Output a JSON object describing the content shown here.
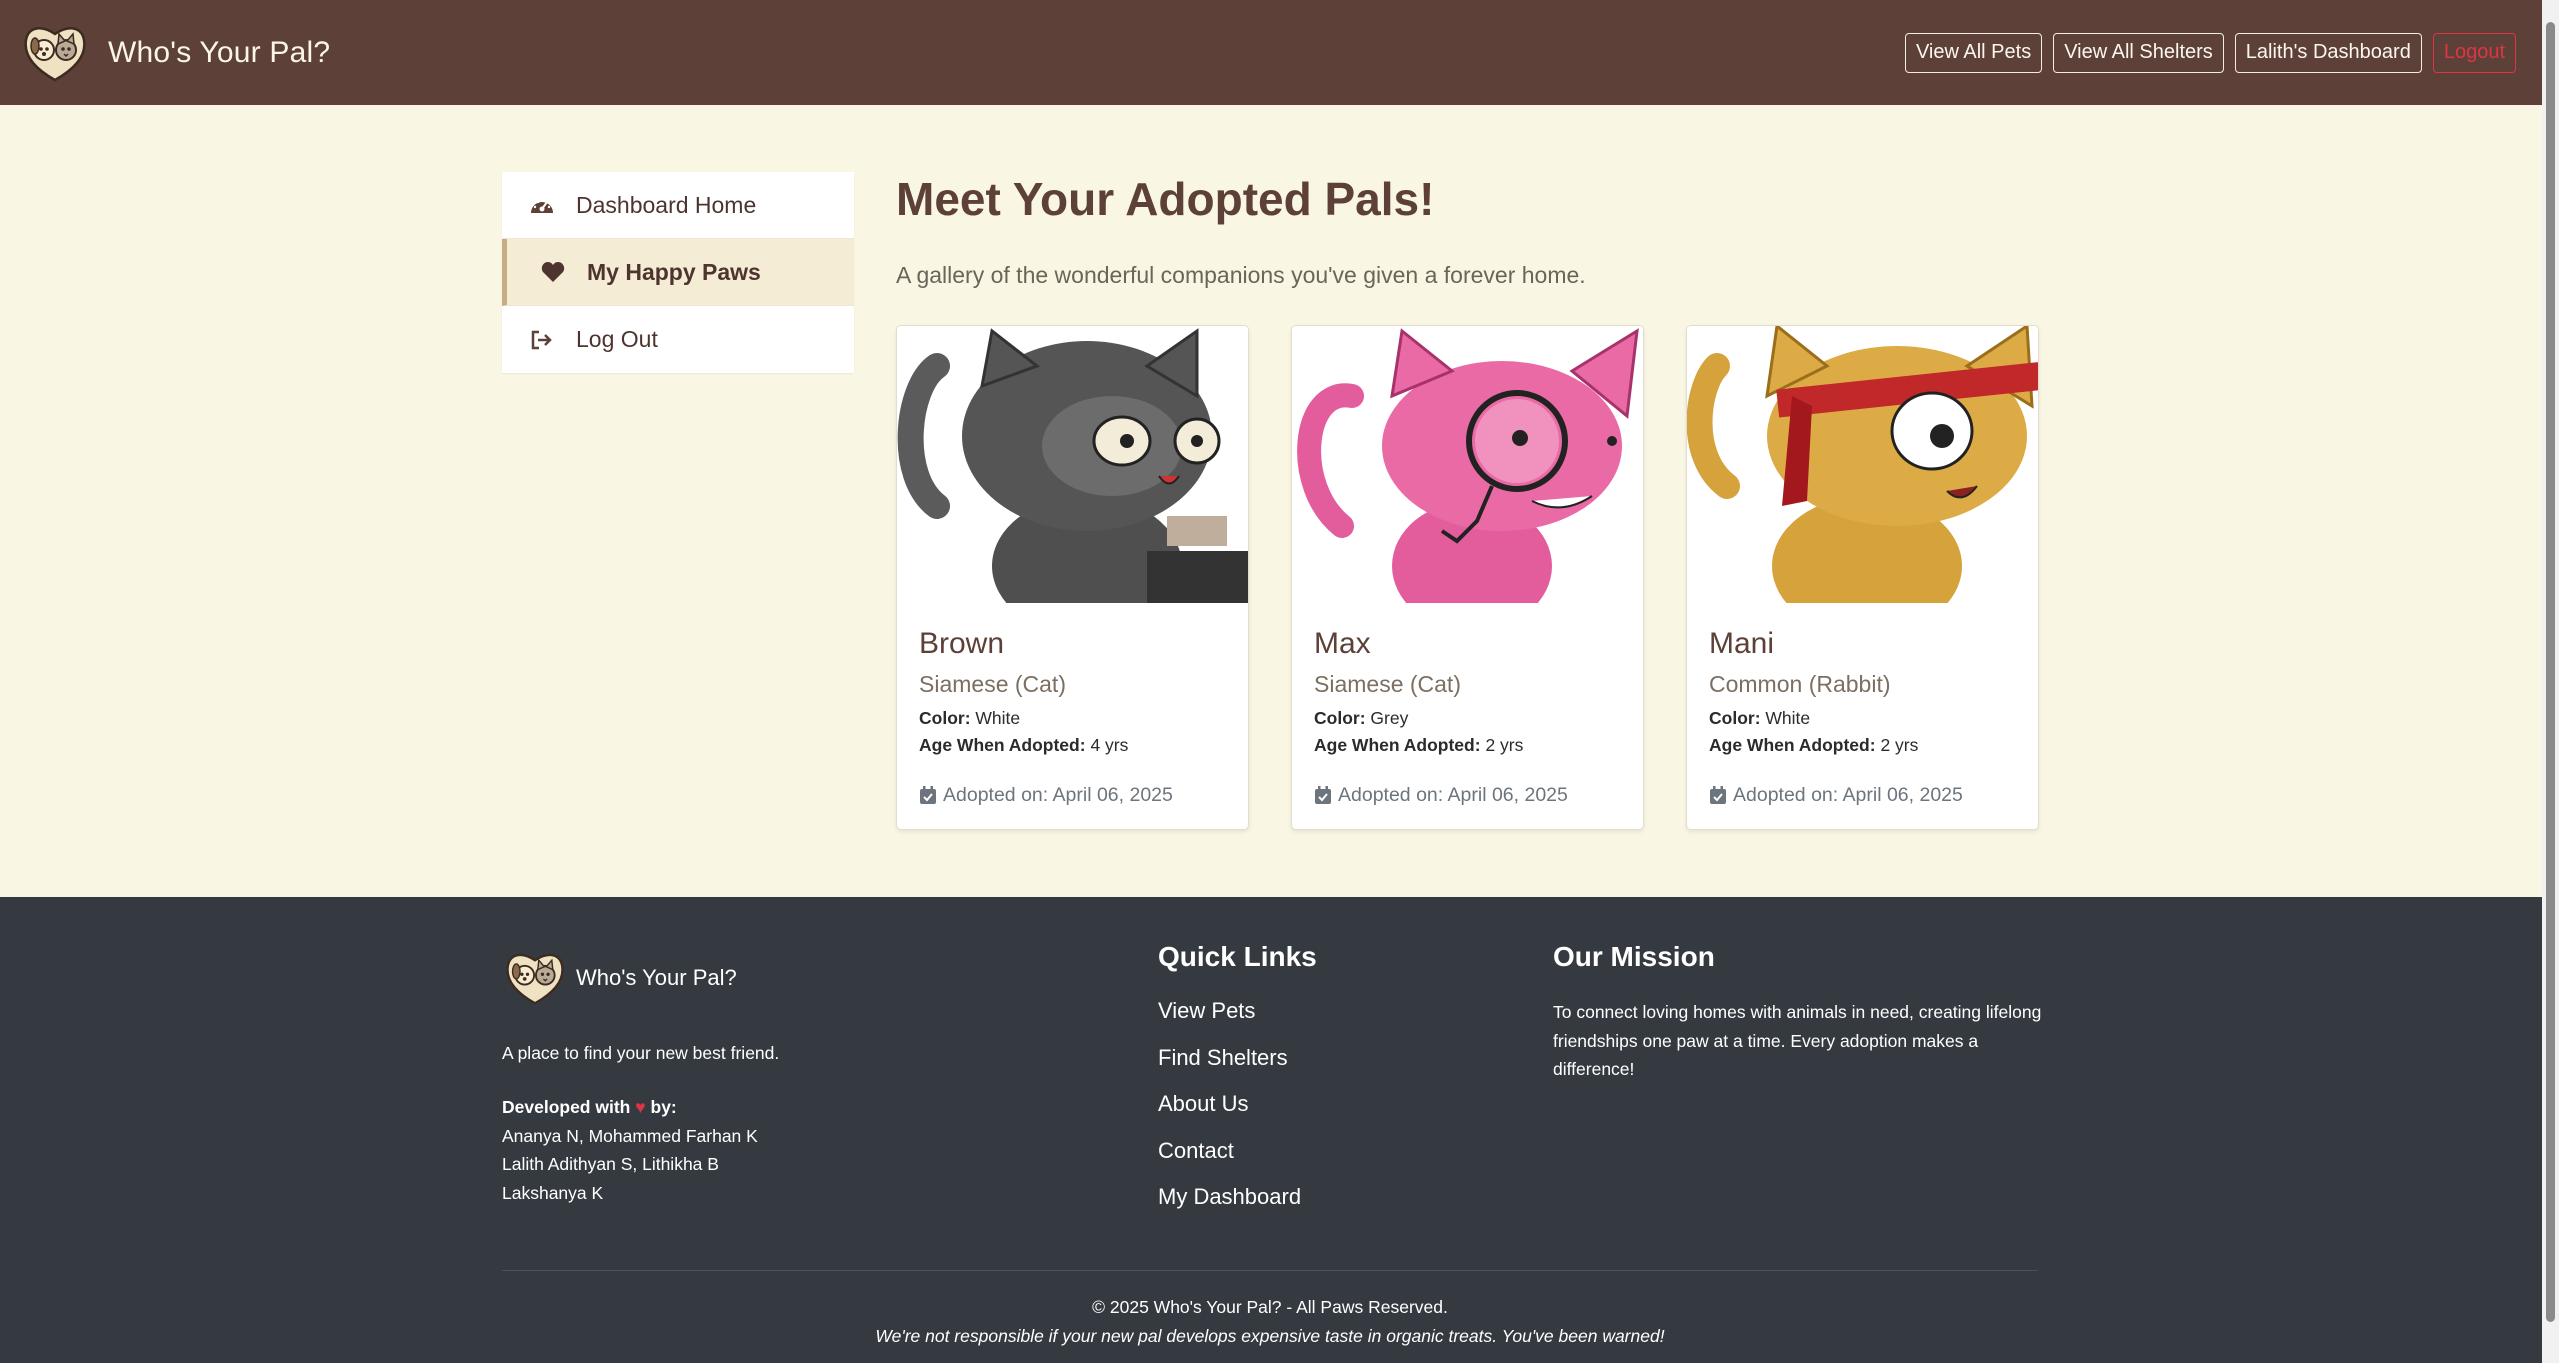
{
  "navbar": {
    "brand": "Who's Your Pal?",
    "buttons": {
      "view_pets": "View All Pets",
      "view_shelters": "View All Shelters",
      "dashboard": "Lalith's Dashboard",
      "logout": "Logout"
    }
  },
  "sidebar": {
    "items": [
      {
        "label": "Dashboard Home",
        "icon": "dashboard-icon"
      },
      {
        "label": "My Happy Paws",
        "icon": "heart-icon",
        "active": true
      },
      {
        "label": "Log Out",
        "icon": "sign-out-icon"
      }
    ]
  },
  "main": {
    "title": "Meet Your Adopted Pals!",
    "subtitle": "A gallery of the wonderful companions you've given a forever home.",
    "color_label": "Color:",
    "age_label": "Age When Adopted:",
    "pets": [
      {
        "name": "Brown",
        "breed": "Siamese (Cat)",
        "color": "White",
        "age": "4 yrs",
        "adopted": "Adopted on: April 06, 2025"
      },
      {
        "name": "Max",
        "breed": "Siamese (Cat)",
        "color": "Grey",
        "age": "2 yrs",
        "adopted": "Adopted on: April 06, 2025"
      },
      {
        "name": "Mani",
        "breed": "Common (Rabbit)",
        "color": "White",
        "age": "2 yrs",
        "adopted": "Adopted on: April 06, 2025"
      }
    ]
  },
  "footer": {
    "brand": "Who's Your Pal?",
    "tagline": "A place to find your new best friend.",
    "developed_prefix": "Developed with",
    "developed_suffix": "by:",
    "developers": [
      "Ananya N, Mohammed Farhan K",
      "Lalith Adithyan S, Lithikha B",
      "Lakshanya K"
    ],
    "quick_links_title": "Quick Links",
    "quick_links": [
      "View Pets",
      "Find Shelters",
      "About Us",
      "Contact",
      "My Dashboard"
    ],
    "mission_title": "Our Mission",
    "mission_text": "To connect loving homes with animals in need, creating lifelong friendships one paw at a time. Every adoption makes a difference!",
    "copyright": "© 2025 Who's Your Pal? - All Paws Reserved.",
    "note": "We're not responsible if your new pal develops expensive taste in organic treats. You've been warned!"
  },
  "colors": {
    "navbar": "#5d4037",
    "page_bg": "#faf6e4",
    "footer": "#343a40",
    "accent": "#c9ad82",
    "danger": "#dc3545"
  }
}
